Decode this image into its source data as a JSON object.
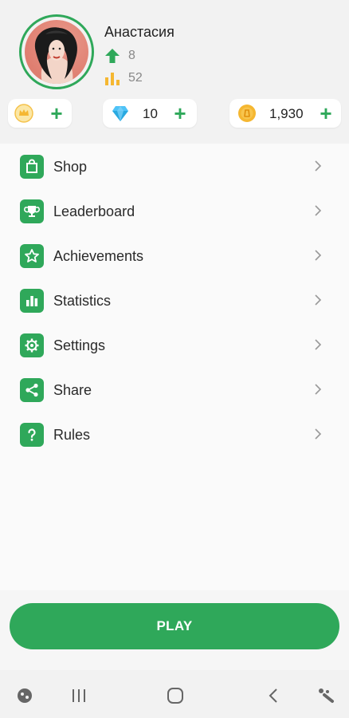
{
  "profile": {
    "name": "Анастасия",
    "level": "8",
    "games": "52"
  },
  "currency": {
    "crown_add": "+",
    "gems": "10",
    "gems_add": "+",
    "coins": "1,930",
    "coins_add": "+"
  },
  "menu": {
    "items": [
      {
        "label": "Shop",
        "icon": "shopping-bag-icon"
      },
      {
        "label": "Leaderboard",
        "icon": "trophy-icon"
      },
      {
        "label": "Achievements",
        "icon": "star-icon"
      },
      {
        "label": "Statistics",
        "icon": "bar-chart-icon"
      },
      {
        "label": "Settings",
        "icon": "gear-icon"
      },
      {
        "label": "Share",
        "icon": "share-icon"
      },
      {
        "label": "Rules",
        "icon": "question-icon"
      }
    ]
  },
  "play_label": "PLAY",
  "colors": {
    "accent": "#2fa85a",
    "background": "#f2f2f2",
    "gold": "#f5b731",
    "diamond": "#4fc3f7"
  }
}
